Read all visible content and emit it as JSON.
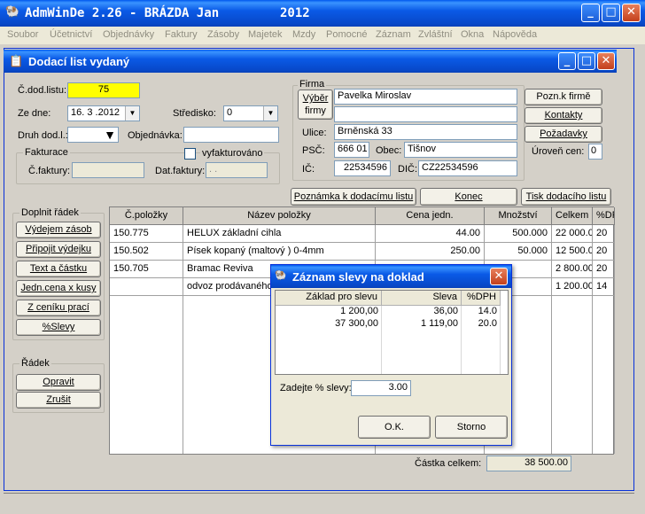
{
  "app": {
    "title": "AdmWinDe 2.26 - BRÁZDA Jan",
    "year": "2012"
  },
  "menu": [
    "Soubor",
    "Účetnictví",
    "Objednávky",
    "Faktury",
    "Zásoby",
    "Majetek",
    "Mzdy",
    "Pomocné",
    "Záznam",
    "Zvláštní",
    "Okna",
    "Nápověda"
  ],
  "window": {
    "title": "Dodací list vydaný"
  },
  "form": {
    "cdod_label": "Č.dod.listu:",
    "cdod_value": "75",
    "zedne_label": "Ze dne:",
    "zedne_value": "16. 3 .2012",
    "stredisko_label": "Středisko:",
    "stredisko_value": "0",
    "druh_label": "Druh dod.l.:",
    "objednavka_label": "Objednávka:",
    "fakturace_label": "Fakturace",
    "vyfakturovano_label": "vyfakturováno",
    "cfaktury_label": "Č.faktury:",
    "datfaktury_label": "Dat.faktury:",
    "datfaktury_value": ". .",
    "firma_label": "Firma",
    "vyber_label1": "Výběr",
    "vyber_label2": "firmy",
    "firma_name": "Pavelka Miroslav",
    "firma_name2": "",
    "ulice_label": "Ulice:",
    "ulice_value": "Brněnská 33",
    "psc_label": "PSČ:",
    "psc_value": "666 01",
    "obec_label": "Obec:",
    "obec_value": "Tišnov",
    "ic_label": "IČ:",
    "ic_value": "22534596",
    "dic_label": "DIČ:",
    "dic_value": "CZ22534596",
    "pozn_firme": "Pozn.k firmě",
    "kontakty": "Kontakty",
    "pozadavky": "Požadavky",
    "uroven_label": "Úroveň cen:",
    "uroven_value": "0"
  },
  "actions": {
    "poznamka": "Poznámka k dodacímu listu",
    "konec": "Konec",
    "tisk": "Tisk dodacího listu"
  },
  "doplnit": {
    "title": "Doplnit řádek",
    "buttons": [
      "Výdejem zásob",
      "Připojit výdejku",
      "Text a částku",
      "Jedn.cena x kusy",
      "Z ceníku prací",
      "%Slevy"
    ]
  },
  "radek": {
    "title": "Řádek",
    "buttons": [
      "Opravit",
      "Zrušit"
    ]
  },
  "table": {
    "headers": [
      "Č.položky",
      "Název položky",
      "Cena jedn.",
      "Množství",
      "Celkem",
      "%DPH"
    ],
    "rows": [
      [
        "150.775",
        "HELUX základní cihla",
        "44.00",
        "500.000",
        "22 000.00",
        "20"
      ],
      [
        "150.502",
        "Písek kopaný (maltový ) 0-4mm",
        "250.00",
        "50.000",
        "12 500.00",
        "20"
      ],
      [
        "150.705",
        "Bramac Reviva",
        "",
        "",
        "2 800.00",
        "20"
      ],
      [
        "",
        "odvoz prodávaného",
        "",
        "",
        "1 200.00",
        "14"
      ]
    ]
  },
  "total": {
    "label": "Částka celkem:",
    "value": "38 500.00"
  },
  "dialog": {
    "title": "Záznam slevy na doklad",
    "headers": [
      "Základ pro slevu",
      "Sleva",
      "%DPH"
    ],
    "rows": [
      [
        "1 200,00",
        "36,00",
        "14.0"
      ],
      [
        "37 300,00",
        "1 119,00",
        "20.0"
      ]
    ],
    "prompt": "Zadejte % slevy:",
    "value": "3.00",
    "ok": "O.K.",
    "storno": "Storno"
  },
  "colors": {
    "accent": "#0a5ae6",
    "highlight": "#ffff00"
  }
}
